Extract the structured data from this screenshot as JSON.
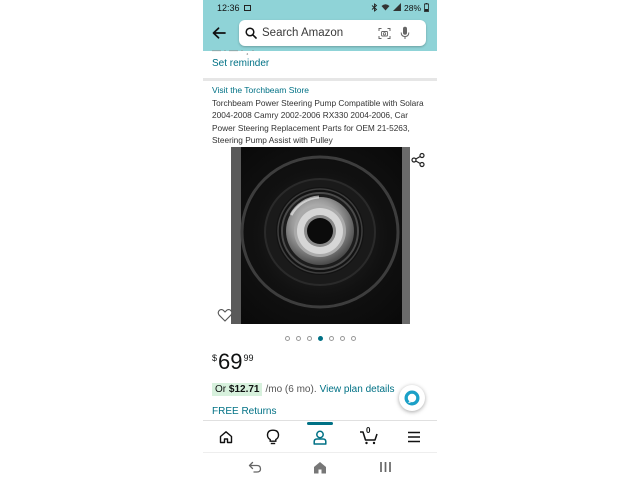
{
  "status_bar": {
    "time": "12:36",
    "battery": "28%"
  },
  "search": {
    "placeholder": "Search Amazon"
  },
  "content": {
    "cut_text": "— · — · ¸ ·",
    "set_reminder": "Set reminder",
    "store_link": "Visit the Torchbeam Store",
    "title": "Torchbeam Power Steering Pump Compatible with Solara 2004-2008 Camry 2002-2006 RX330 2004-2006, Car Power Steering Replacement Parts for OEM 21-5263, Steering Pump Assist with Pulley"
  },
  "carousel": {
    "count": 7,
    "active_index": 3
  },
  "price": {
    "currency": "$",
    "whole": "69",
    "fraction": "99"
  },
  "plan": {
    "prefix": "Or",
    "amount": "$12.71",
    "term": "/mo (6 mo).",
    "link": "View plan details"
  },
  "free_returns": "FREE Returns",
  "bottom_nav": {
    "cart_count": "0",
    "active": "account"
  },
  "colors": {
    "header": "#8fd3d7",
    "link": "#007185",
    "plan_badge": "#d7f1dd"
  }
}
